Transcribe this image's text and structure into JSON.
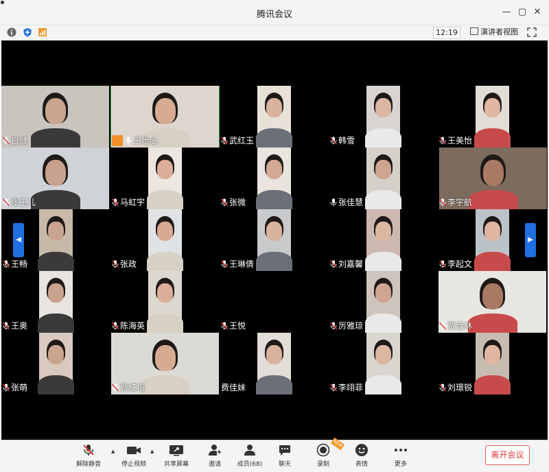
{
  "window": {
    "title": "腾讯会议",
    "controls": [
      "minimize",
      "maximize",
      "close"
    ]
  },
  "toolbar": {
    "clock": "12:19",
    "view_label": "演讲者视图",
    "icons": [
      "info-icon",
      "shield-icon",
      "signal-icon",
      "fullscreen-icon"
    ]
  },
  "participants": [
    {
      "name": "白健",
      "muted": true
    },
    {
      "name": "王怡心",
      "muted": false,
      "host": true,
      "speaking": true
    },
    {
      "name": "武红玉",
      "muted": true
    },
    {
      "name": "韩雪",
      "muted": true
    },
    {
      "name": "王美怡",
      "muted": true
    },
    {
      "name": "张玉儿",
      "muted": true
    },
    {
      "name": "马虹宇",
      "muted": true
    },
    {
      "name": "张微",
      "muted": true
    },
    {
      "name": "张佳慧",
      "muted": false
    },
    {
      "name": "李宇航",
      "muted": true
    },
    {
      "name": "王畅",
      "muted": true
    },
    {
      "name": "张政",
      "muted": true
    },
    {
      "name": "王琳倩",
      "muted": true
    },
    {
      "name": "刘嘉馨",
      "muted": true
    },
    {
      "name": "李起文",
      "muted": true
    },
    {
      "name": "王奥",
      "muted": true
    },
    {
      "name": "陈海英",
      "muted": true
    },
    {
      "name": "王悦",
      "muted": true
    },
    {
      "name": "厉雅琼",
      "muted": true
    },
    {
      "name": "贾鑫林",
      "muted": true
    },
    {
      "name": "张萌",
      "muted": true
    },
    {
      "name": "费红梅",
      "muted": true
    },
    {
      "name": "费佳妹",
      "muted": false,
      "noicon": true
    },
    {
      "name": "李翊菲",
      "muted": true
    },
    {
      "name": "刘璟锐",
      "muted": true
    }
  ],
  "bottom_bar": {
    "unmute": "解除静音",
    "stop_video": "停止视频",
    "share_screen": "共享屏幕",
    "invite": "邀请",
    "members": "成员(68)",
    "chat": "聊天",
    "record": "录制",
    "reactions": "表情",
    "more": "更多",
    "leave": "离开会议",
    "new_badge": "NEW"
  },
  "colors": {
    "accent": "#1f6fe0",
    "leave": "#e03a3a",
    "host_badge": "#f0902b",
    "speaking_outline": "#3aa64a"
  }
}
